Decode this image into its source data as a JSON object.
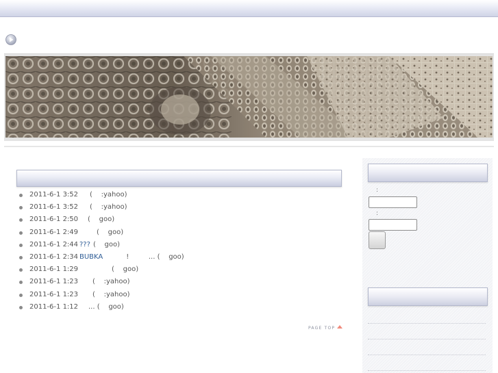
{
  "header": {
    "brand_color": "#cfd3e6"
  },
  "banner": {
    "description_icon": "play-icon"
  },
  "main": {
    "section_title": "",
    "entries": [
      {
        "date": "2011-6-1 3:52",
        "text": "(    :yahoo)",
        "link": ""
      },
      {
        "date": "2011-6-1 3:52",
        "text": "(    :yahoo)",
        "link": ""
      },
      {
        "date": "2011-6-1 2:50",
        "text": "(    goo)",
        "link": ""
      },
      {
        "date": "2011-6-1 2:49",
        "text": "(    goo)",
        "link": ""
      },
      {
        "date": "2011-6-1 2:44",
        "link": "???",
        "text": "(    goo)"
      },
      {
        "date": "2011-6-1 2:34",
        "link": "BUBKA",
        "text": "!         ... (    goo)"
      },
      {
        "date": "2011-6-1 1:29",
        "text": "(    goo)",
        "link": ""
      },
      {
        "date": "2011-6-1 1:23",
        "text": "(    :yahoo)",
        "link": ""
      },
      {
        "date": "2011-6-1 1:23",
        "text": "(    :yahoo)",
        "link": ""
      },
      {
        "date": "2011-6-1 1:12",
        "text": "... (    goo)",
        "link": ""
      }
    ],
    "page_top_label": "PAGE TOP"
  },
  "sidebar": {
    "login_title": "",
    "user_label": ":",
    "password_label": ":",
    "user_value": "",
    "password_value": "",
    "login_button_label": "",
    "second_title": ""
  }
}
